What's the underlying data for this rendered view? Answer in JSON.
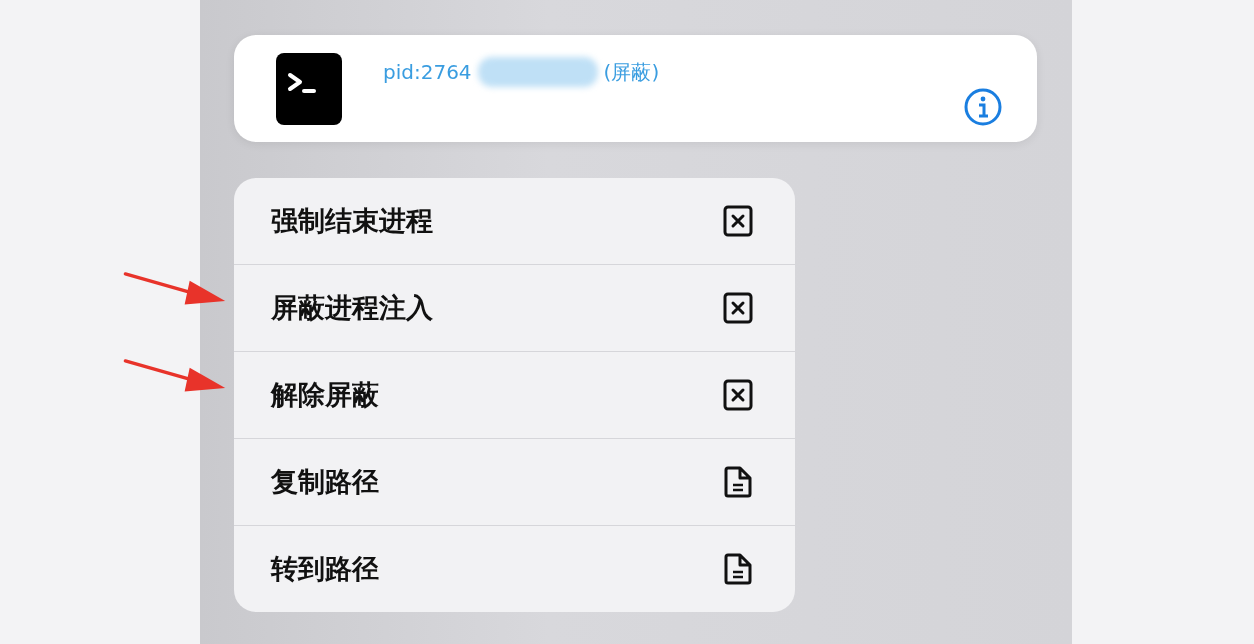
{
  "header": {
    "pid": "pid:2764",
    "tag": "(屏蔽)"
  },
  "menu": [
    {
      "label": "强制结束进程",
      "kind": "xmark",
      "marked": false
    },
    {
      "label": "屏蔽进程注入",
      "kind": "xmark",
      "marked": true
    },
    {
      "label": "解除屏蔽",
      "kind": "xmark",
      "marked": true
    },
    {
      "label": "复制路径",
      "kind": "document",
      "marked": false
    },
    {
      "label": "转到路径",
      "kind": "document",
      "marked": false
    }
  ]
}
